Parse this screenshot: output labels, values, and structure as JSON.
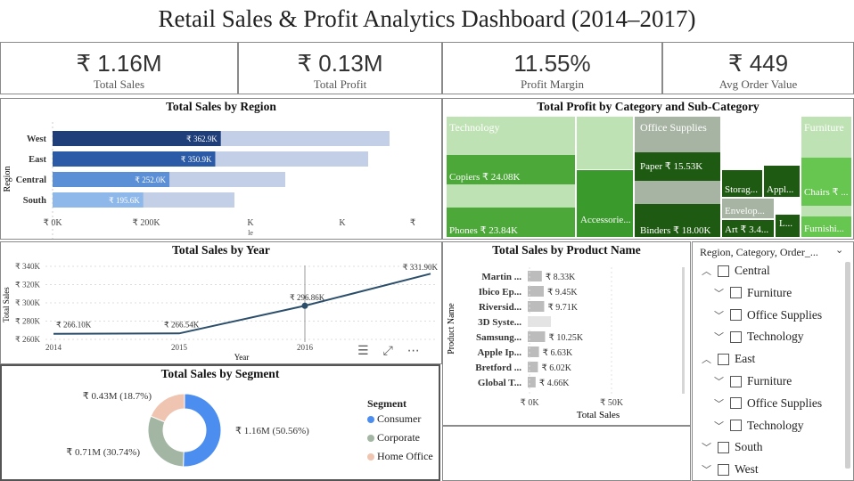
{
  "title": "Retail Sales & Profit Analytics Dashboard (2014–2017)",
  "kpis": [
    {
      "value": "₹ 1.16M",
      "label": "Total Sales"
    },
    {
      "value": "₹ 0.13M",
      "label": "Total Profit"
    },
    {
      "value": "11.55%",
      "label": "Profit Margin"
    },
    {
      "value": "₹ 449",
      "label": "Avg Order Value"
    }
  ],
  "region_chart": {
    "title": "Total Sales by Region",
    "ylabel": "Region",
    "rows": [
      {
        "name": "West",
        "value": 362.9,
        "label": "₹ 362.9K",
        "color": "#1f3f7a",
        "ghost": 436
      },
      {
        "name": "East",
        "value": 350.9,
        "label": "₹ 350.9K",
        "color": "#2b5aa6",
        "ghost": 412
      },
      {
        "name": "Central",
        "value": 252.0,
        "label": "₹ 252.0K",
        "color": "#5b8fd6",
        "ghost": 319
      },
      {
        "name": "South",
        "value": 195.6,
        "label": "₹ 195.6K",
        "color": "#8eb8ea",
        "ghost": 262
      }
    ],
    "ticks": [
      "₹ 0K",
      "₹ 200K",
      "K",
      "K",
      "₹"
    ],
    "xlabel": "le"
  },
  "treemap": {
    "title": "Total Profit by Category and Sub-Category",
    "categories": [
      "Technology",
      "Office Supplies",
      "Furniture"
    ],
    "labels": {
      "copiers": "Copiers ₹ 24.08K",
      "phones": "Phones ₹ 23.84K",
      "accessories": "Accessorie...",
      "paper": "Paper ₹ 15.53K",
      "binders": "Binders ₹ 18.00K",
      "storage": "Storag...",
      "appliances": "Appl...",
      "envelopes": "Envelop...",
      "art": "Art ₹ 3.4...",
      "labels": "L...",
      "chairs": "Chairs ₹ ...",
      "furnishings": "Furnishi..."
    }
  },
  "year_chart": {
    "title": "Total Sales by Year",
    "xlabel": "Year",
    "ylabel": "Total Sales",
    "yticks": [
      "₹ 340K",
      "₹ 320K",
      "₹ 300K",
      "₹ 280K",
      "₹ 260K"
    ],
    "xticks": [
      "2014",
      "2015",
      "2016"
    ],
    "points": [
      {
        "year": 2014,
        "value": 266.1,
        "label": "₹ 266.10K"
      },
      {
        "year": 2015,
        "value": 266.54,
        "label": "₹ 266.54K"
      },
      {
        "year": 2016,
        "value": 296.86,
        "label": "₹ 296.86K"
      },
      {
        "year": 2017,
        "value": 331.9,
        "label": "₹ 331.90K"
      }
    ]
  },
  "product_chart": {
    "title": "Total Sales by Product Name",
    "ylabel": "Product Name",
    "xlabel": "Total Sales",
    "xticks": [
      "₹ 0K",
      "₹ 50K"
    ],
    "rows": [
      {
        "name": "Martin ...",
        "value": 8.33,
        "label": "₹ 8.33K"
      },
      {
        "name": "Ibico Ep...",
        "value": 9.45,
        "label": "₹ 9.45K"
      },
      {
        "name": "Riversid...",
        "value": 9.71,
        "label": "₹ 9.71K"
      },
      {
        "name": "3D Syste...",
        "value": 0,
        "label": ""
      },
      {
        "name": "Samsung...",
        "value": 10.25,
        "label": "₹ 10.25K"
      },
      {
        "name": "Apple Ip...",
        "value": 6.63,
        "label": "₹ 6.63K"
      },
      {
        "name": "Bretford ...",
        "value": 6.02,
        "label": "₹ 6.02K"
      },
      {
        "name": "Global T...",
        "value": 4.66,
        "label": "₹ 4.66K"
      }
    ]
  },
  "segment_chart": {
    "title": "Total Sales by Segment",
    "legend_title": "Segment",
    "slices": [
      {
        "name": "Consumer",
        "value": 50.56,
        "label": "₹ 1.16M (50.56%)",
        "color": "#4c8ef0"
      },
      {
        "name": "Corporate",
        "value": 30.74,
        "label": "₹ 0.71M (30.74%)",
        "color": "#a3b5a3"
      },
      {
        "name": "Home Office",
        "value": 18.7,
        "label": "₹ 0.43M (18.7%)",
        "color": "#efc4b0"
      }
    ]
  },
  "slicer": {
    "header": "Region, Category, Order_...",
    "items": [
      {
        "label": "Central",
        "level": 0,
        "chev": "up"
      },
      {
        "label": "Furniture",
        "level": 1,
        "chev": "down"
      },
      {
        "label": "Office Supplies",
        "level": 1,
        "chev": "down"
      },
      {
        "label": "Technology",
        "level": 1,
        "chev": "down"
      },
      {
        "label": "East",
        "level": 0,
        "chev": "up"
      },
      {
        "label": "Furniture",
        "level": 1,
        "chev": "down"
      },
      {
        "label": "Office Supplies",
        "level": 1,
        "chev": "down"
      },
      {
        "label": "Technology",
        "level": 1,
        "chev": "down"
      },
      {
        "label": "South",
        "level": 0,
        "chev": "down"
      },
      {
        "label": "West",
        "level": 0,
        "chev": "down"
      }
    ]
  },
  "chart_data": [
    {
      "type": "bar",
      "title": "Total Sales by Region",
      "categories": [
        "West",
        "East",
        "Central",
        "South"
      ],
      "values": [
        362.9,
        350.9,
        252.0,
        195.6
      ],
      "ylabel": "Region",
      "xlabel": ""
    },
    {
      "type": "line",
      "title": "Total Sales by Year",
      "x": [
        2014,
        2015,
        2016,
        2017
      ],
      "values": [
        266.1,
        266.54,
        296.86,
        331.9
      ],
      "xlabel": "Year",
      "ylabel": "Total Sales",
      "ylim": [
        260,
        340
      ]
    },
    {
      "type": "bar",
      "title": "Total Sales by Product Name",
      "categories": [
        "Martin ...",
        "Ibico Ep...",
        "Riversid...",
        "3D Syste...",
        "Samsung...",
        "Apple Ip...",
        "Bretford ...",
        "Global T..."
      ],
      "values": [
        8.33,
        9.45,
        9.71,
        0,
        10.25,
        6.63,
        6.02,
        4.66
      ],
      "xlabel": "Total Sales",
      "ylabel": "Product Name"
    },
    {
      "type": "pie",
      "title": "Total Sales by Segment",
      "categories": [
        "Consumer",
        "Corporate",
        "Home Office"
      ],
      "values": [
        50.56,
        30.74,
        18.7
      ]
    }
  ]
}
